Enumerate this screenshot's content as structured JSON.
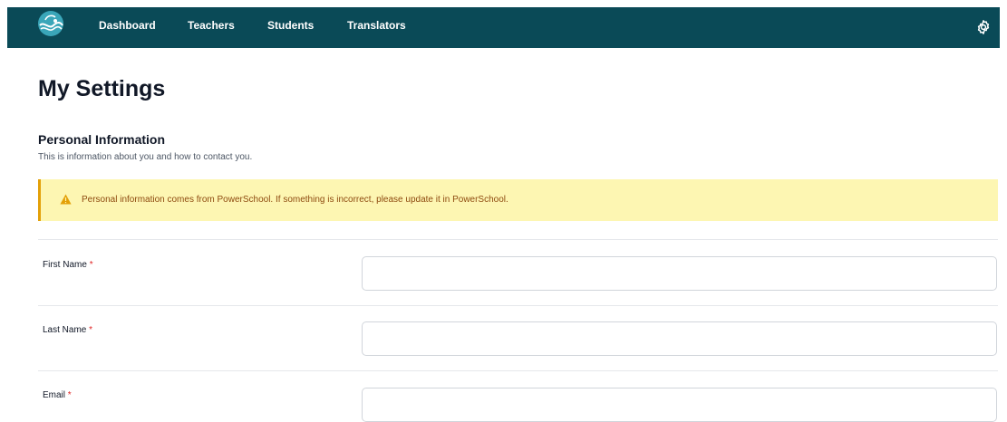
{
  "nav": {
    "logo_icon": "wave-globe-logo",
    "links": [
      "Dashboard",
      "Teachers",
      "Students",
      "Translators"
    ],
    "settings_icon": "gear-icon",
    "background": "#0a4a57"
  },
  "page": {
    "title": "My Settings"
  },
  "section": {
    "title": "Personal Information",
    "description": "This is information about you and how to contact you."
  },
  "alert": {
    "icon": "warning-triangle-icon",
    "text": "Personal information comes from PowerSchool. If something is incorrect, please update it in PowerSchool.",
    "background": "#fdf6b2",
    "accent": "#e3a008"
  },
  "form": {
    "required_marker": "*",
    "fields": [
      {
        "label": "First Name",
        "value": "",
        "required": true
      },
      {
        "label": "Last Name",
        "value": "",
        "required": true
      },
      {
        "label": "Email",
        "value": "",
        "required": true
      }
    ]
  }
}
